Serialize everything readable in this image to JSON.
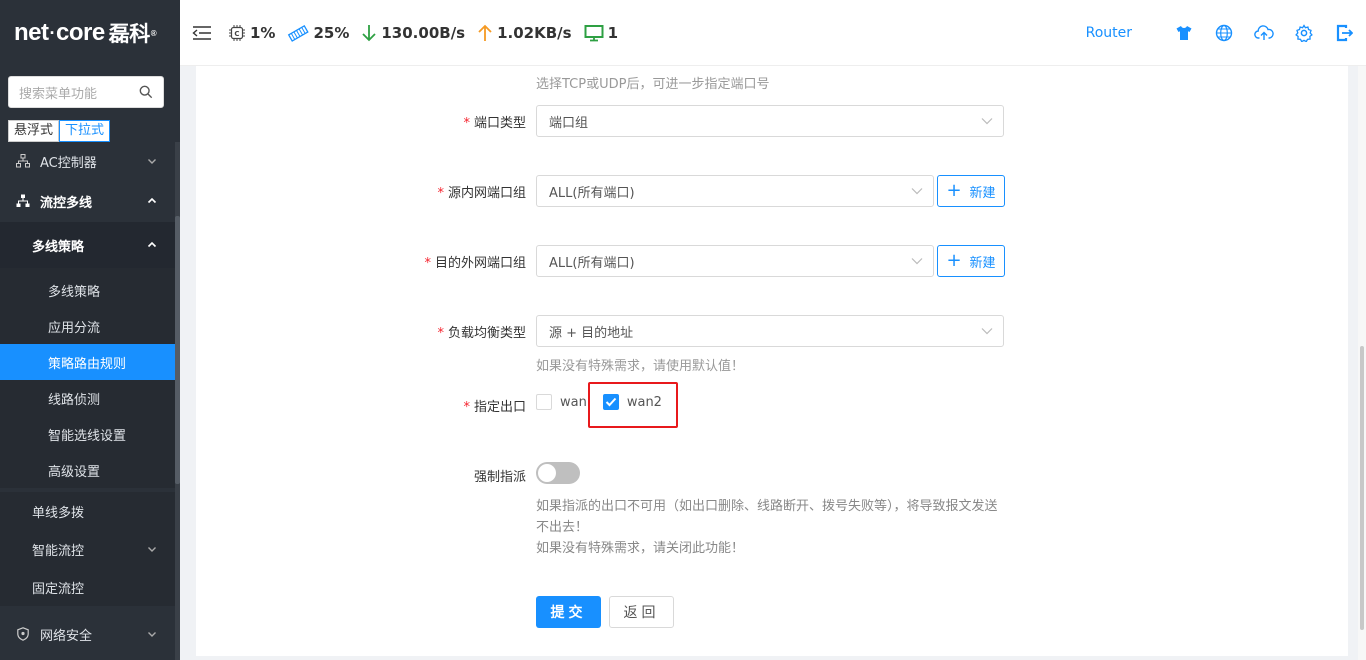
{
  "brand": {
    "logo_text": "net·core磊科"
  },
  "sidebar": {
    "search_placeholder": "搜索菜单功能",
    "mode_float": "悬浮式",
    "mode_dropdown": "下拉式",
    "items": {
      "ac": "AC控制器",
      "flow_multi": "流控多线",
      "multi_policy_group": "多线策略",
      "multi_policy": "多线策略",
      "app_split": "应用分流",
      "policy_route": "策略路由规则",
      "line_detect": "线路侦测",
      "smart_select": "智能选线设置",
      "advanced": "高级设置",
      "single_multi": "单线多拨",
      "smart_flow": "智能流控",
      "fixed_flow": "固定流控",
      "net_security": "网络安全"
    }
  },
  "header": {
    "cpu": "1%",
    "mem": "25%",
    "down": "130.00B/s",
    "up": "1.02KB/s",
    "devices": "1",
    "router": "Router"
  },
  "form": {
    "proto_hint": "选择TCP或UDP后，可进一步指定端口号",
    "port_type_label": "端口类型",
    "port_type_value": "端口组",
    "src_port_label": "源内网端口组",
    "src_port_value": "ALL(所有端口)",
    "new_label": "新建",
    "dst_port_label": "目的外网端口组",
    "dst_port_value": "ALL(所有端口)",
    "lb_label": "负载均衡类型",
    "lb_value": "源 + 目的地址",
    "lb_hint": "如果没有特殊需求，请使用默认值！",
    "exit_label": "指定出口",
    "exit_wan": "wan",
    "exit_wan2": "wan2",
    "force_label": "强制指派",
    "force_note_1": "如果指派的出口不可用（如出口删除、线路断开、拨号失败等），将导致报文发送不出去！",
    "force_note_2": "如果没有特殊需求，请关闭此功能！",
    "submit": "提交",
    "back": "返回"
  },
  "colors": {
    "accent": "#1890ff",
    "sidebar_bg": "#2b3139",
    "highlight": "#e8191c",
    "required": "#f5222d"
  }
}
